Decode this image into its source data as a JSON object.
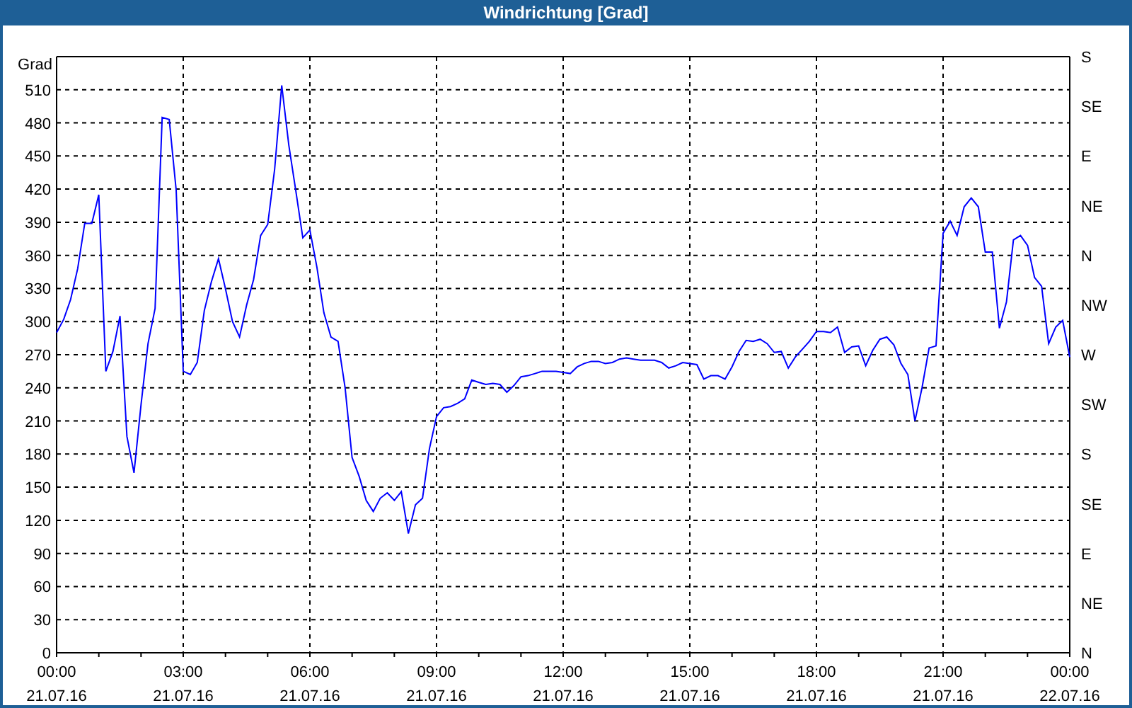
{
  "window": {
    "title": "Windrichtung [Grad]"
  },
  "chart": {
    "compass_labels": [
      "S",
      "SE",
      "E",
      "NE",
      "N",
      "NW",
      "W",
      "SW",
      "S",
      "SE",
      "E",
      "NE",
      "N"
    ],
    "chart_data": {
      "type": "line",
      "grid": true,
      "ylabel": "Grad",
      "ylim": [
        0,
        540
      ],
      "categories": [
        "00:00\n21.07.16",
        null,
        null,
        null,
        null,
        null,
        null,
        null,
        null,
        null,
        null,
        null,
        null,
        null,
        null,
        null,
        null,
        null,
        "03:00\n21.07.16",
        null,
        null,
        null,
        null,
        null,
        null,
        null,
        null,
        null,
        null,
        null,
        null,
        null,
        null,
        null,
        null,
        null,
        "06:00\n21.07.16",
        null,
        null,
        null,
        null,
        null,
        null,
        null,
        null,
        null,
        null,
        null,
        null,
        null,
        null,
        null,
        null,
        null,
        "09:00\n21.07.16",
        null,
        null,
        null,
        null,
        null,
        null,
        null,
        null,
        null,
        null,
        null,
        null,
        null,
        null,
        null,
        null,
        null,
        "12:00\n21.07.16",
        null,
        null,
        null,
        null,
        null,
        null,
        null,
        null,
        null,
        null,
        null,
        null,
        null,
        null,
        null,
        null,
        null,
        "15:00\n21.07.16",
        null,
        null,
        null,
        null,
        null,
        null,
        null,
        null,
        null,
        null,
        null,
        null,
        null,
        null,
        null,
        null,
        null,
        "18:00\n21.07.16",
        null,
        null,
        null,
        null,
        null,
        null,
        null,
        null,
        null,
        null,
        null,
        null,
        null,
        null,
        null,
        null,
        null,
        "21:00\n21.07.16",
        null,
        null,
        null,
        null,
        null,
        null,
        null,
        null,
        null,
        null,
        null,
        null,
        null,
        null,
        null,
        null,
        null,
        "00:00\n22.07.16"
      ],
      "series": [
        {
          "color": "#0000ff",
          "values": [
            290,
            302,
            320,
            348,
            389,
            389,
            415,
            255,
            273,
            305,
            196,
            163,
            225,
            280,
            312,
            485,
            483,
            419,
            255,
            252,
            263,
            310,
            336,
            357,
            330,
            300,
            286,
            315,
            338,
            378,
            388,
            438,
            514,
            460,
            418,
            376,
            383,
            349,
            308,
            286,
            282,
            240,
            177,
            160,
            138,
            128,
            140,
            145,
            138,
            146,
            108,
            134,
            140,
            185,
            214,
            222,
            223,
            226,
            230,
            247,
            245,
            243,
            244,
            243,
            236,
            242,
            250,
            251,
            253,
            255,
            255,
            255,
            254,
            253,
            259,
            262,
            264,
            264,
            262,
            263,
            266,
            267,
            266,
            265,
            265,
            265,
            263,
            258,
            260,
            263,
            262,
            261,
            248,
            251,
            251,
            248,
            259,
            273,
            283,
            282,
            284,
            280,
            272,
            273,
            258,
            268,
            275,
            282,
            291,
            291,
            290,
            295,
            272,
            277,
            278,
            260,
            274,
            284,
            286,
            279,
            262,
            252,
            210,
            240,
            276,
            278,
            380,
            391,
            378,
            404,
            412,
            404,
            363,
            363,
            294,
            318,
            374,
            378,
            369,
            340,
            332,
            280,
            295,
            301,
            268
          ]
        }
      ],
      "yticks": [
        0,
        30,
        60,
        90,
        120,
        150,
        180,
        210,
        240,
        270,
        300,
        330,
        360,
        390,
        420,
        450,
        480,
        510
      ]
    }
  }
}
